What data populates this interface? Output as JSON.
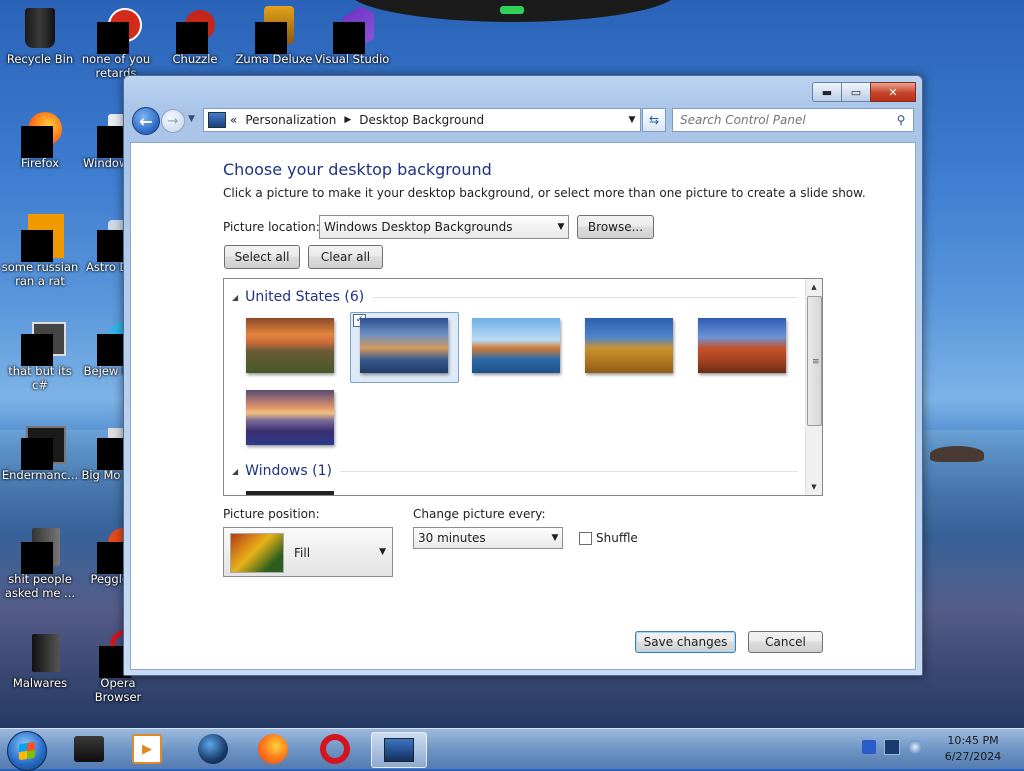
{
  "desktop": {
    "icons": [
      {
        "label": "Recycle Bin"
      },
      {
        "label": "none of you retards"
      },
      {
        "label": "Chuzzle"
      },
      {
        "label": "Zuma Deluxe"
      },
      {
        "label": "Visual Studio"
      },
      {
        "label": "Firefox"
      },
      {
        "label": "Window Ma"
      },
      {
        "label": "some russian ran a rat"
      },
      {
        "label": "Astro Delu"
      },
      {
        "label": "that but its c#"
      },
      {
        "label": "Bejew Delu"
      },
      {
        "label": "Endermanc..."
      },
      {
        "label": "Big Mo Delu"
      },
      {
        "label": "shit people asked me ..."
      },
      {
        "label": "Peggle D"
      },
      {
        "label": "Malwares"
      },
      {
        "label": "Opera Browser"
      }
    ]
  },
  "window": {
    "breadcrumb": [
      "Personalization",
      "Desktop Background"
    ],
    "breadcrumb_prefix": "«",
    "search_placeholder": "Search Control Panel",
    "caption": {
      "min": "▬",
      "max": "▭",
      "close": "✕"
    }
  },
  "page": {
    "heading": "Choose your desktop background",
    "description": "Click a picture to make it your desktop background, or select more than one picture to create a slide show.",
    "picture_location_label": "Picture location:",
    "picture_location_value": "Windows Desktop Backgrounds",
    "browse_label": "Browse...",
    "select_all_label": "Select all",
    "clear_all_label": "Clear all",
    "groups": [
      {
        "title": "United States (6)",
        "count": 6
      },
      {
        "title": "Windows (1)",
        "count": 1
      }
    ],
    "selected_thumbnail_index": 1,
    "picture_position_label": "Picture position:",
    "picture_position_value": "Fill",
    "change_every_label": "Change picture every:",
    "change_every_value": "30 minutes",
    "shuffle_label": "Shuffle",
    "shuffle_checked": false,
    "save_label": "Save changes",
    "cancel_label": "Cancel"
  },
  "taskbar": {
    "clock_time": "10:45 PM",
    "clock_date": "6/27/2024",
    "pinned": [
      "terminal",
      "media-player",
      "blender",
      "firefox",
      "opera",
      "control-panel"
    ]
  }
}
